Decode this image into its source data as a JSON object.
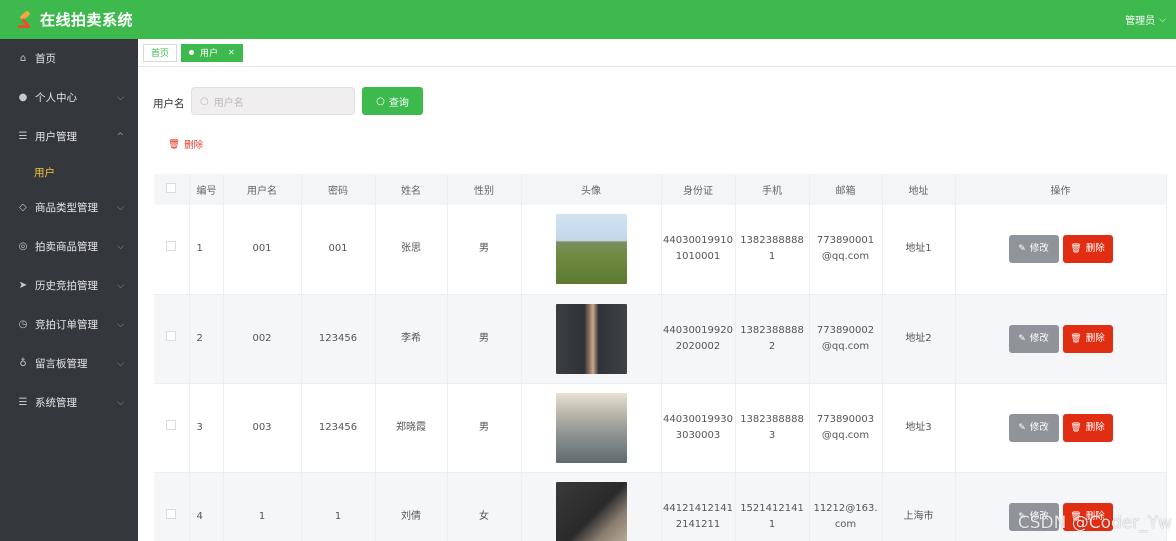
{
  "header": {
    "title": "在线拍卖系统",
    "user": "管理员"
  },
  "sidebar": {
    "items": [
      {
        "label": "首页",
        "icon": "home-icon",
        "arrow": ""
      },
      {
        "label": "个人中心",
        "icon": "person-icon",
        "arrow": "down"
      },
      {
        "label": "用户管理",
        "icon": "list-icon",
        "arrow": "up"
      },
      {
        "label": "商品类型管理",
        "icon": "tag-icon",
        "arrow": "down"
      },
      {
        "label": "拍卖商品管理",
        "icon": "gavel-icon",
        "arrow": "down"
      },
      {
        "label": "历史竞拍管理",
        "icon": "send-icon",
        "arrow": "down"
      },
      {
        "label": "竞拍订单管理",
        "icon": "clock-icon",
        "arrow": "down"
      },
      {
        "label": "留言板管理",
        "icon": "mic-icon",
        "arrow": "down"
      },
      {
        "label": "系统管理",
        "icon": "list-icon",
        "arrow": "down"
      }
    ],
    "sub_item": "用户"
  },
  "tabs": [
    {
      "label": "首页",
      "active": false
    },
    {
      "label": "用户",
      "active": true
    }
  ],
  "search": {
    "label": "用户名",
    "placeholder": "用户名",
    "button": "查询"
  },
  "actions": {
    "delete": "删除"
  },
  "table": {
    "headers": [
      "",
      "编号",
      "用户名",
      "密码",
      "姓名",
      "性别",
      "头像",
      "身份证",
      "手机",
      "邮箱",
      "地址",
      "操作"
    ],
    "rows": [
      {
        "no": "1",
        "username": "001",
        "password": "001",
        "name": "张思",
        "gender": "男",
        "idcard": "44030019910 1010001",
        "phone": "1382388888 1",
        "email": "773890001 @qq.com",
        "address": "地址1"
      },
      {
        "no": "2",
        "username": "002",
        "password": "123456",
        "name": "李希",
        "gender": "男",
        "idcard": "44030019920 2020002",
        "phone": "1382388888 2",
        "email": "773890002 @qq.com",
        "address": "地址2"
      },
      {
        "no": "3",
        "username": "003",
        "password": "123456",
        "name": "郑晓霞",
        "gender": "男",
        "idcard": "44030019930 3030003",
        "phone": "1382388888 3",
        "email": "773890003 @qq.com",
        "address": "地址3"
      },
      {
        "no": "4",
        "username": "1",
        "password": "1",
        "name": "刘倩",
        "gender": "女",
        "idcard": "44121412141 2141211",
        "phone": "1521412141 1",
        "email": "11212@163. com",
        "address": "上海市"
      }
    ],
    "edit_label": "修改",
    "delete_label": "删除"
  },
  "watermark": "CSDN @Coder_Yw",
  "colors": {
    "primary": "#3db94d",
    "sidebar": "#34383c",
    "danger": "#e12d11",
    "edit": "#909399",
    "submenu_active": "#f4c542"
  }
}
